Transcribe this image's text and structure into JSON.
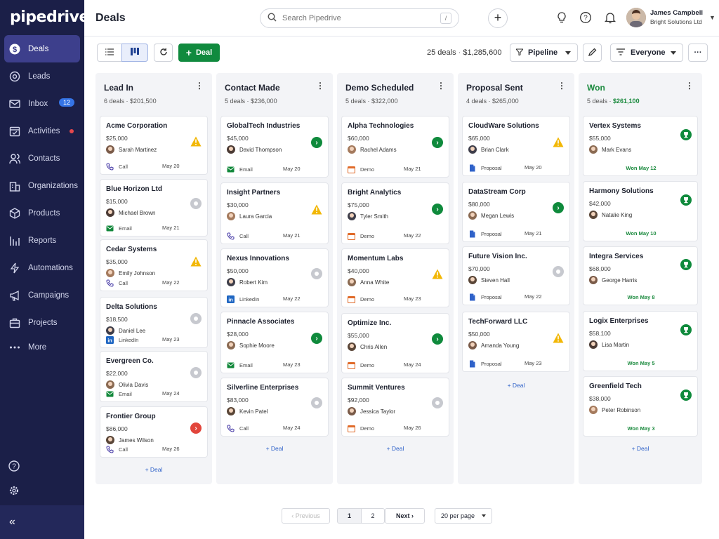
{
  "app": {
    "logo": "pipedrive",
    "page_title": "Deals"
  },
  "sidebar": {
    "items": [
      {
        "label": "Deals",
        "icon": "dollar-icon",
        "active": true
      },
      {
        "label": "Leads",
        "icon": "target-icon"
      },
      {
        "label": "Inbox",
        "icon": "mail-icon",
        "badge": "12"
      },
      {
        "label": "Activities",
        "icon": "calendar-icon",
        "dot": true
      },
      {
        "label": "Contacts",
        "icon": "people-icon"
      },
      {
        "label": "Organizations",
        "icon": "building-icon"
      },
      {
        "label": "Products",
        "icon": "box-icon"
      },
      {
        "label": "Reports",
        "icon": "chart-icon"
      },
      {
        "label": "Automations",
        "icon": "bolt-icon"
      },
      {
        "label": "Campaigns",
        "icon": "megaphone-icon"
      },
      {
        "label": "Projects",
        "icon": "briefcase-icon"
      },
      {
        "label": "More",
        "icon": "dots-icon"
      }
    ],
    "collapse": "«"
  },
  "search": {
    "placeholder": "Search Pipedrive",
    "shortcut": "/"
  },
  "user": {
    "name": "James Campbell",
    "org": "Bright Solutions Ltd"
  },
  "toolbar": {
    "add_deal": "Deal",
    "summary_count": "25 deals",
    "summary_sep": "·",
    "summary_total": "$1,285,600",
    "pipeline": "Pipeline",
    "filter": "Everyone",
    "more": "···"
  },
  "columns": [
    {
      "title": "Lead In",
      "count": "6 deals",
      "total": "$201,500",
      "add": "+ Deal",
      "cards": [
        {
          "name": "Acme Corporation",
          "value": "$25,000",
          "person": "Sarah Martinez",
          "activity": "Call",
          "date": "May 20",
          "status": "warn"
        },
        {
          "name": "Blue Horizon Ltd",
          "value": "$15,000",
          "person": "Michael Brown",
          "activity": "Email",
          "date": "May 21",
          "status": "grey"
        },
        {
          "name": "Cedar Systems",
          "value": "$35,000",
          "person": "Emily Johnson",
          "activity": "Call",
          "date": "May 22",
          "status": "warn"
        },
        {
          "name": "Delta Solutions",
          "value": "$18,500",
          "person": "Daniel Lee",
          "activity": "LinkedIn",
          "date": "May 23",
          "status": "grey"
        },
        {
          "name": "Evergreen Co.",
          "value": "$22,000",
          "person": "Olivia Davis",
          "activity": "Email",
          "date": "May 24",
          "status": "grey"
        },
        {
          "name": "Frontier Group",
          "value": "$86,000",
          "person": "James Wilson",
          "activity": "Call",
          "date": "May 26",
          "status": "red"
        }
      ]
    },
    {
      "title": "Contact Made",
      "count": "5 deals",
      "total": "$236,000",
      "add": "+ Deal",
      "cards": [
        {
          "name": "GlobalTech Industries",
          "value": "$45,000",
          "person": "David Thompson",
          "activity": "Email",
          "date": "May 20",
          "status": "green"
        },
        {
          "name": "Insight Partners",
          "value": "$30,000",
          "person": "Laura Garcia",
          "activity": "Call",
          "date": "May 21",
          "status": "warn"
        },
        {
          "name": "Nexus Innovations",
          "value": "$50,000",
          "person": "Robert Kim",
          "activity": "LinkedIn",
          "date": "May 22",
          "status": "grey"
        },
        {
          "name": "Pinnacle Associates",
          "value": "$28,000",
          "person": "Sophie Moore",
          "activity": "Email",
          "date": "May 23",
          "status": "green"
        },
        {
          "name": "Silverline Enterprises",
          "value": "$83,000",
          "person": "Kevin Patel",
          "activity": "Call",
          "date": "May 24",
          "status": "grey"
        }
      ]
    },
    {
      "title": "Demo Scheduled",
      "count": "5 deals",
      "total": "$322,000",
      "add": "+ Deal",
      "cards": [
        {
          "name": "Alpha Technologies",
          "value": "$60,000",
          "person": "Rachel Adams",
          "activity": "Demo",
          "date": "May 21",
          "status": "green"
        },
        {
          "name": "Bright Analytics",
          "value": "$75,000",
          "person": "Tyler Smith",
          "activity": "Demo",
          "date": "May 22",
          "status": "green"
        },
        {
          "name": "Momentum Labs",
          "value": "$40,000",
          "person": "Anna White",
          "activity": "Demo",
          "date": "May 23",
          "status": "warn"
        },
        {
          "name": "Optimize Inc.",
          "value": "$55,000",
          "person": "Chris Allen",
          "activity": "Demo",
          "date": "May 24",
          "status": "green"
        },
        {
          "name": "Summit Ventures",
          "value": "$92,000",
          "person": "Jessica Taylor",
          "activity": "Demo",
          "date": "May 26",
          "status": "grey"
        }
      ]
    },
    {
      "title": "Proposal Sent",
      "count": "4 deals",
      "total": "$265,000",
      "add": "+ Deal",
      "cards": [
        {
          "name": "CloudWare Solutions",
          "value": "$65,000",
          "person": "Brian Clark",
          "activity": "Proposal",
          "date": "May 20",
          "status": "warn"
        },
        {
          "name": "DataStream Corp",
          "value": "$80,000",
          "person": "Megan Lewis",
          "activity": "Proposal",
          "date": "May 21",
          "status": "green"
        },
        {
          "name": "Future Vision Inc.",
          "value": "$70,000",
          "person": "Steven Hall",
          "activity": "Proposal",
          "date": "May 22",
          "status": "grey"
        },
        {
          "name": "TechForward LLC",
          "value": "$50,000",
          "person": "Amanda Young",
          "activity": "Proposal",
          "date": "May 23",
          "status": "warn"
        }
      ]
    },
    {
      "title": "Won",
      "count": "5 deals",
      "total": "$261,100",
      "add": "+ Deal",
      "won": true,
      "cards": [
        {
          "name": "Vertex Systems",
          "value": "$55,000",
          "person": "Mark Evans",
          "won_date": "Won May 12"
        },
        {
          "name": "Harmony Solutions",
          "value": "$42,000",
          "person": "Natalie King",
          "won_date": "Won May 10"
        },
        {
          "name": "Integra Services",
          "value": "$68,000",
          "person": "George Harris",
          "won_date": "Won May 8"
        },
        {
          "name": "Logix Enterprises",
          "value": "$58,100",
          "person": "Lisa Martin",
          "won_date": "Won May 5"
        },
        {
          "name": "Greenfield Tech",
          "value": "$38,000",
          "person": "Peter Robinson",
          "won_date": "Won May 3"
        }
      ]
    }
  ],
  "pagination": {
    "previous": "‹ Previous",
    "pages": [
      "1",
      "2"
    ],
    "next": "Next ›",
    "per_page": "20 per page"
  },
  "colors": {
    "sidebar": "#1b1f48",
    "accent_green": "#108a3e",
    "won": "#1b8a3e",
    "link": "#2f62c9",
    "warn": "#f2b705"
  }
}
